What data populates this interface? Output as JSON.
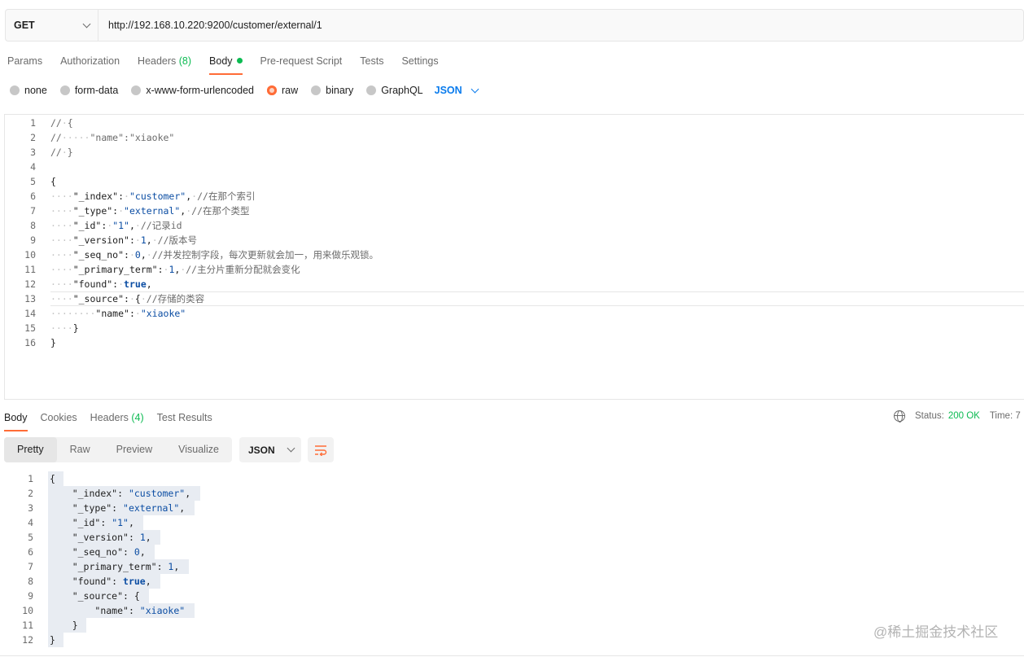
{
  "request": {
    "method": "GET",
    "url": "http://192.168.10.220:9200/customer/external/1"
  },
  "request_tabs": [
    {
      "label": "Params"
    },
    {
      "label": "Authorization"
    },
    {
      "label": "Headers",
      "count": "(8)"
    },
    {
      "label": "Body"
    },
    {
      "label": "Pre-request Script"
    },
    {
      "label": "Tests"
    },
    {
      "label": "Settings"
    }
  ],
  "body_types": [
    "none",
    "form-data",
    "x-www-form-urlencoded",
    "raw",
    "binary",
    "GraphQL"
  ],
  "body_format": "JSON",
  "request_body_lines": [
    [
      [
        "c-comment",
        "//"
      ],
      [
        "ws",
        "·"
      ],
      [
        "c-comment",
        "{"
      ]
    ],
    [
      [
        "c-comment",
        "//"
      ],
      [
        "ws",
        "·····"
      ],
      [
        "c-comment",
        "\"name\":\"xiaoke\""
      ]
    ],
    [
      [
        "c-comment",
        "//"
      ],
      [
        "ws",
        "·"
      ],
      [
        "c-comment",
        "}"
      ]
    ],
    [],
    [
      [
        "c-punc",
        "{"
      ]
    ],
    [
      [
        "ws",
        "····"
      ],
      [
        "c-key",
        "\"_index\""
      ],
      [
        "c-punc",
        ":"
      ],
      [
        "ws",
        "·"
      ],
      [
        "c-str",
        "\"customer\""
      ],
      [
        "c-punc",
        ","
      ],
      [
        "ws",
        "·"
      ],
      [
        "c-comment",
        "//在那个索引"
      ]
    ],
    [
      [
        "ws",
        "····"
      ],
      [
        "c-key",
        "\"_type\""
      ],
      [
        "c-punc",
        ":"
      ],
      [
        "ws",
        "·"
      ],
      [
        "c-str",
        "\"external\""
      ],
      [
        "c-punc",
        ","
      ],
      [
        "ws",
        "·"
      ],
      [
        "c-comment",
        "//在那个类型"
      ]
    ],
    [
      [
        "ws",
        "····"
      ],
      [
        "c-key",
        "\"_id\""
      ],
      [
        "c-punc",
        ":"
      ],
      [
        "ws",
        "·"
      ],
      [
        "c-str",
        "\"1\""
      ],
      [
        "c-punc",
        ","
      ],
      [
        "ws",
        "·"
      ],
      [
        "c-comment",
        "//记录id"
      ]
    ],
    [
      [
        "ws",
        "····"
      ],
      [
        "c-key",
        "\"_version\""
      ],
      [
        "c-punc",
        ":"
      ],
      [
        "ws",
        "·"
      ],
      [
        "c-num",
        "1"
      ],
      [
        "c-punc",
        ","
      ],
      [
        "ws",
        "·"
      ],
      [
        "c-comment",
        "//版本号"
      ]
    ],
    [
      [
        "ws",
        "····"
      ],
      [
        "c-key",
        "\"_seq_no\""
      ],
      [
        "c-punc",
        ":"
      ],
      [
        "ws",
        "·"
      ],
      [
        "c-num",
        "0"
      ],
      [
        "c-punc",
        ","
      ],
      [
        "ws",
        "·"
      ],
      [
        "c-comment",
        "//并发控制字段，每次更新就会加一，用来做乐观锁。"
      ]
    ],
    [
      [
        "ws",
        "····"
      ],
      [
        "c-key",
        "\"_primary_term\""
      ],
      [
        "c-punc",
        ":"
      ],
      [
        "ws",
        "·"
      ],
      [
        "c-num",
        "1"
      ],
      [
        "c-punc",
        ","
      ],
      [
        "ws",
        "·"
      ],
      [
        "c-comment",
        "//主分片重新分配就会变化"
      ]
    ],
    [
      [
        "ws",
        "····"
      ],
      [
        "c-key",
        "\"found\""
      ],
      [
        "c-punc",
        ":"
      ],
      [
        "ws",
        "·"
      ],
      [
        "c-kw",
        "true"
      ],
      [
        "c-punc",
        ","
      ]
    ],
    [
      [
        "ws",
        "····"
      ],
      [
        "c-key",
        "\"_source\""
      ],
      [
        "c-punc",
        ":"
      ],
      [
        "ws",
        "·"
      ],
      [
        "c-punc",
        "{"
      ],
      [
        "ws",
        "·"
      ],
      [
        "c-comment",
        "//存储的类容"
      ]
    ],
    [
      [
        "ws",
        "····"
      ],
      [
        "ws",
        "····"
      ],
      [
        "c-key",
        "\"name\""
      ],
      [
        "c-punc",
        ":"
      ],
      [
        "ws",
        "·"
      ],
      [
        "c-str",
        "\"xiaoke\""
      ]
    ],
    [
      [
        "ws",
        "····"
      ],
      [
        "c-punc",
        "}"
      ]
    ],
    [
      [
        "c-punc",
        "}"
      ]
    ]
  ],
  "response_tabs": [
    {
      "label": "Body"
    },
    {
      "label": "Cookies"
    },
    {
      "label": "Headers",
      "count": "(4)"
    },
    {
      "label": "Test Results"
    }
  ],
  "response_meta": {
    "status_label": "Status:",
    "status_value": "200 OK",
    "time_label": "Time: 7"
  },
  "view_modes": [
    "Pretty",
    "Raw",
    "Preview",
    "Visualize"
  ],
  "response_format": "JSON",
  "response_body_lines": [
    [
      [
        "c-punc",
        "{"
      ]
    ],
    [
      [
        "ws",
        "    "
      ],
      [
        "c-key",
        "\"_index\""
      ],
      [
        "c-punc",
        ": "
      ],
      [
        "c-str",
        "\"customer\""
      ],
      [
        "c-punc",
        ","
      ]
    ],
    [
      [
        "ws",
        "    "
      ],
      [
        "c-key",
        "\"_type\""
      ],
      [
        "c-punc",
        ": "
      ],
      [
        "c-str",
        "\"external\""
      ],
      [
        "c-punc",
        ","
      ]
    ],
    [
      [
        "ws",
        "    "
      ],
      [
        "c-key",
        "\"_id\""
      ],
      [
        "c-punc",
        ": "
      ],
      [
        "c-str",
        "\"1\""
      ],
      [
        "c-punc",
        ","
      ]
    ],
    [
      [
        "ws",
        "    "
      ],
      [
        "c-key",
        "\"_version\""
      ],
      [
        "c-punc",
        ": "
      ],
      [
        "c-num",
        "1"
      ],
      [
        "c-punc",
        ","
      ]
    ],
    [
      [
        "ws",
        "    "
      ],
      [
        "c-key",
        "\"_seq_no\""
      ],
      [
        "c-punc",
        ": "
      ],
      [
        "c-num",
        "0"
      ],
      [
        "c-punc",
        ","
      ]
    ],
    [
      [
        "ws",
        "    "
      ],
      [
        "c-key",
        "\"_primary_term\""
      ],
      [
        "c-punc",
        ": "
      ],
      [
        "c-num",
        "1"
      ],
      [
        "c-punc",
        ","
      ]
    ],
    [
      [
        "ws",
        "    "
      ],
      [
        "c-key",
        "\"found\""
      ],
      [
        "c-punc",
        ": "
      ],
      [
        "c-kw",
        "true"
      ],
      [
        "c-punc",
        ","
      ]
    ],
    [
      [
        "ws",
        "    "
      ],
      [
        "c-key",
        "\"_source\""
      ],
      [
        "c-punc",
        ": {"
      ]
    ],
    [
      [
        "ws",
        "        "
      ],
      [
        "c-key",
        "\"name\""
      ],
      [
        "c-punc",
        ": "
      ],
      [
        "c-str",
        "\"xiaoke\""
      ]
    ],
    [
      [
        "ws",
        "    "
      ],
      [
        "c-punc",
        "}"
      ]
    ],
    [
      [
        "c-punc",
        "}"
      ]
    ]
  ],
  "watermark": "@稀土掘金技术社区"
}
